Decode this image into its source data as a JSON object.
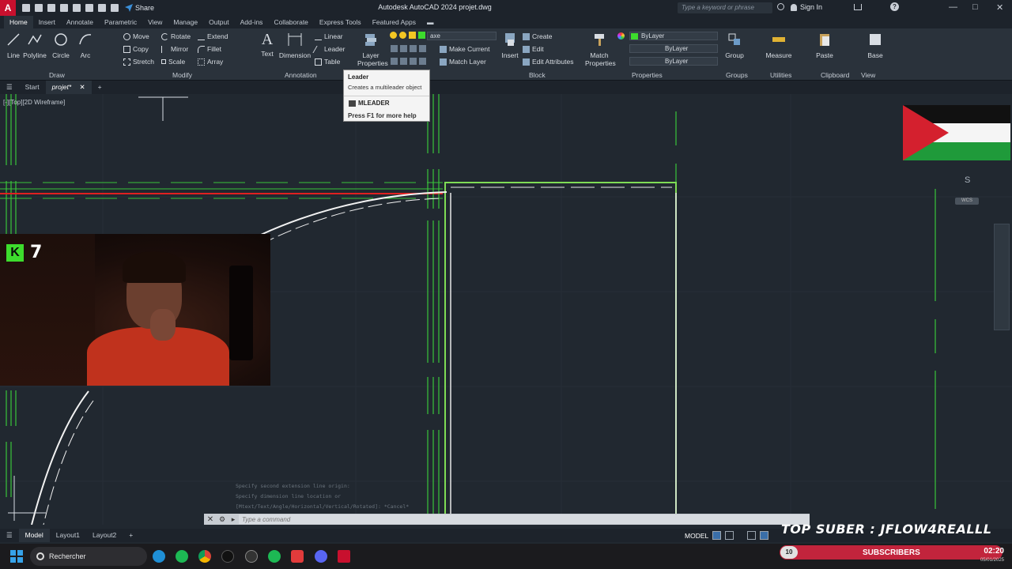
{
  "titlebar": {
    "app_logo": "A",
    "share_label": "Share",
    "title": "Autodesk AutoCAD 2024   projet.dwg",
    "search_placeholder": "Type a keyword or phrase",
    "sign_in": "Sign In",
    "help": "?"
  },
  "ribbon_tabs": [
    "Home",
    "Insert",
    "Annotate",
    "Parametric",
    "View",
    "Manage",
    "Output",
    "Add-ins",
    "Collaborate",
    "Express Tools",
    "Featured Apps"
  ],
  "ribbon": {
    "draw": {
      "title": "Draw",
      "line": "Line",
      "polyline": "Polyline",
      "circle": "Circle",
      "arc": "Arc"
    },
    "modify": {
      "title": "Modify",
      "move": "Move",
      "rotate": "Rotate",
      "extend": "Extend",
      "copy": "Copy",
      "mirror": "Mirror",
      "fillet": "Fillet",
      "stretch": "Stretch",
      "scale": "Scale",
      "array": "Array"
    },
    "annotation": {
      "title": "Annotation",
      "text": "Text",
      "dimension": "Dimension",
      "linear": "Linear",
      "leader": "Leader",
      "table": "Table"
    },
    "layers": {
      "layer_properties": "Layer Properties",
      "current_layer": "axe",
      "make_current": "Make Current",
      "match_layer": "Match Layer"
    },
    "block": {
      "title": "Block",
      "insert": "Insert",
      "create": "Create",
      "edit": "Edit",
      "edit_attributes": "Edit Attributes"
    },
    "properties": {
      "title": "Properties",
      "match_properties": "Match Properties",
      "color": "ByLayer",
      "linetype": "ByLayer",
      "lineweight": "ByLayer"
    },
    "groups": {
      "title": "Groups",
      "group": "Group"
    },
    "utilities": {
      "title": "Utilities",
      "measure": "Measure"
    },
    "clipboard": {
      "title": "Clipboard",
      "paste": "Paste"
    },
    "view": {
      "title": "View",
      "base": "Base"
    }
  },
  "doc_tabs": {
    "start": "Start",
    "current": "projet*"
  },
  "viewport_label": "[-][Top][2D Wireframe]",
  "tooltip": {
    "title": "Leader",
    "description": "Creates a multileader object",
    "command": "MLEADER",
    "help": "Press F1 for more help"
  },
  "overlay": {
    "badge": "K",
    "number": "7"
  },
  "viewcube": {
    "compass": "S",
    "wcs": "WCS"
  },
  "command_history": [
    "Specify second extension line origin:",
    "Specify dimension line location or",
    "[Mtext/Text/Angle/Horizontal/Vertical/Rotated]: *Cancel*"
  ],
  "command_line": {
    "placeholder": "Type a command"
  },
  "layout_tabs": [
    "Model",
    "Layout1",
    "Layout2"
  ],
  "status": {
    "model": "MODEL"
  },
  "stream_overlay": {
    "top_suber": "TOP SUBER : JFLOW4REALLL",
    "subscriber_count": "10",
    "subscribers_label": "SUBSCRIBERS"
  },
  "taskbar": {
    "search": "Rechercher",
    "time": "02:20",
    "date": "05/01/2025"
  },
  "colors": {
    "accent_green": "#3ddc2d",
    "red_line": "#e02020",
    "autocad_red": "#c8102e",
    "subs_red": "#c2243c"
  }
}
